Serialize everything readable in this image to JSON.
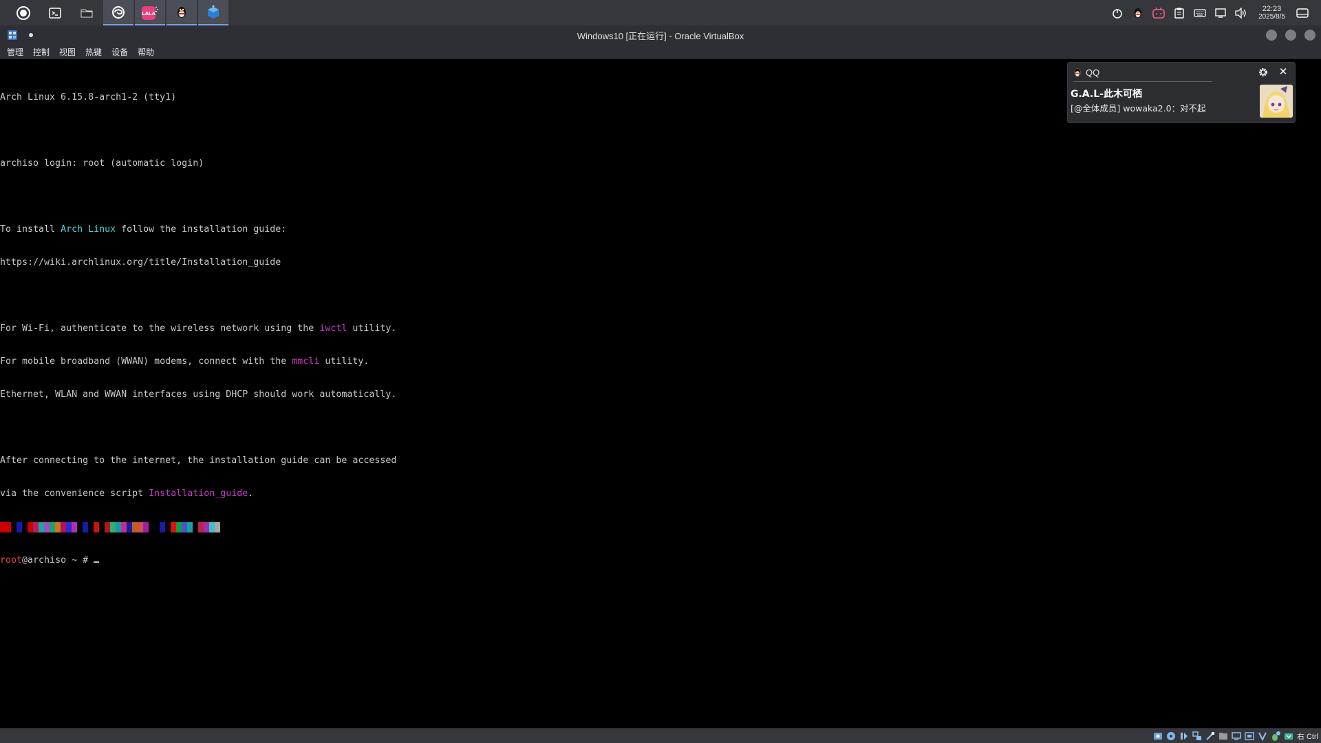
{
  "taskbar": {
    "apps": [
      {
        "name": "launcher",
        "icon": "launcher-icon"
      },
      {
        "name": "terminal",
        "icon": "terminal-icon"
      },
      {
        "name": "file-manager",
        "icon": "folder-icon"
      },
      {
        "name": "browser",
        "icon": "browser-icon"
      },
      {
        "name": "music",
        "icon": "music-app-icon",
        "badge": "LALA"
      },
      {
        "name": "qq",
        "icon": "qq-penguin-icon"
      },
      {
        "name": "virtualbox",
        "icon": "virtualbox-icon"
      }
    ],
    "tray_icons": [
      "power-icon",
      "qq-penguin-icon",
      "bilibili-icon",
      "clipboard-icon",
      "keyboard-icon",
      "display-icon",
      "volume-icon"
    ],
    "clock": {
      "time": "22:23",
      "date": "2025/8/5"
    }
  },
  "window": {
    "title": "Windows10 [正在运行] - Oracle VirtualBox"
  },
  "menubar": {
    "items": [
      "管理",
      "控制",
      "视图",
      "热键",
      "设备",
      "帮助"
    ]
  },
  "console": {
    "lines": {
      "l1": "Arch Linux 6.15.8-arch1-2 (tty1)",
      "l2": "archiso login: root (automatic login)",
      "l3a": "To install ",
      "l3b": "Arch Linux",
      "l3c": " follow the installation guide:",
      "l4": "https://wiki.archlinux.org/title/Installation_guide",
      "l5a": "For Wi-Fi, authenticate to the wireless network using the ",
      "l5b": "iwctl",
      "l5c": " utility.",
      "l6a": "For mobile broadband (WWAN) modems, connect with the ",
      "l6b": "mmcli",
      "l6c": " utility.",
      "l7": "Ethernet, WLAN and WWAN interfaces using DHCP should work automatically.",
      "l8": "After connecting to the internet, the installation guide can be accessed",
      "l9a": "via the convenience script ",
      "l9b": "Installation_guide",
      "l9c": ".",
      "prompt_user": "root",
      "prompt_rest": "@archiso ~ # "
    },
    "color_palette": [
      "#c80000",
      "#c80000",
      "#000000",
      "#1a1aa8",
      "#000000",
      "#c80000",
      "#b02060",
      "#26a0a0",
      "#9a50c0",
      "#20a070",
      "#c87a10",
      "#b01060",
      "#2b2bd0",
      "#b030b0",
      "#000000",
      "#1a1aa8",
      "#000000",
      "#d01010",
      "#000000",
      "#b01818",
      "#30b070",
      "#1898a8",
      "#c03090",
      "#1a1aa8",
      "#c06018",
      "#d05050",
      "#a020a0",
      "#000000",
      "#000000",
      "#1a1aa8",
      "#000000",
      "#e01010",
      "#10a040",
      "#5050d0",
      "#1aa0a0",
      "#000000",
      "#c02050",
      "#a030b0",
      "#40c0c0",
      "#a8a8a8"
    ]
  },
  "notification": {
    "app": "QQ",
    "title": "G.A.L-此木可栖",
    "body": "[@全体成员] wowaka2.0：对不起"
  },
  "statusbar": {
    "icons": [
      "hdd-icon",
      "optical-icon",
      "audio-icon",
      "network-icon",
      "usb-icon",
      "shared-folder-icon",
      "display-icon",
      "recording-icon",
      "vt-x-icon",
      "mouse-icon",
      "keyboard-icon"
    ],
    "host_key": "右 Ctrl"
  }
}
